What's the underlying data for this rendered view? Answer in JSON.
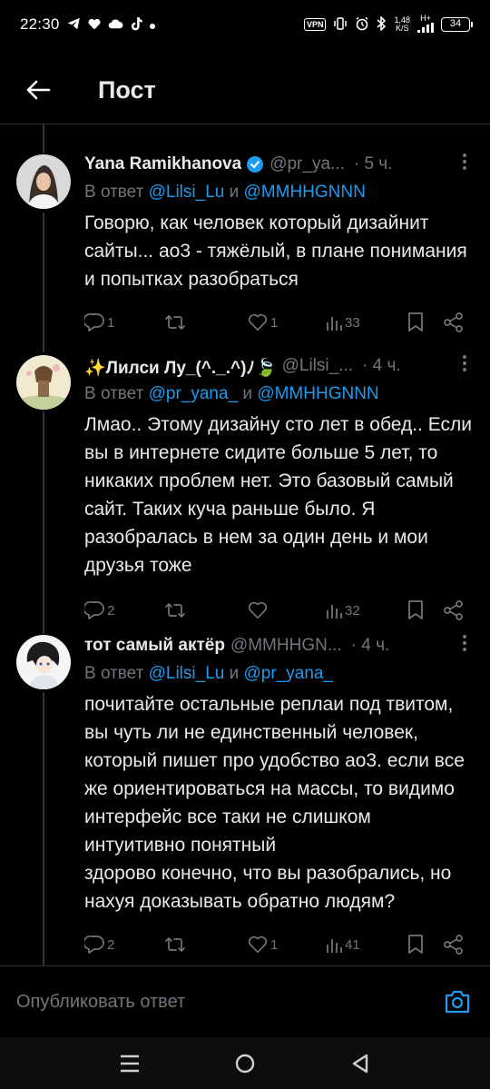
{
  "status_bar": {
    "time": "22:30",
    "vpn": "VPN",
    "speed_value": "1,48",
    "speed_unit": "K/S",
    "network": "H+",
    "battery": "34"
  },
  "header": {
    "title": "Пост"
  },
  "tweets": [
    {
      "name": "Yana Ramikhanova",
      "verified": true,
      "handle": "@pr_ya...",
      "time": "· 5 ч.",
      "reply_prefix": "В ответ ",
      "mention1": "@Lilsi_Lu",
      "conj": " и ",
      "mention2": "@MMHHGNNN",
      "text": "Говорю, как человек который дизайнит сайты... ао3 - тяжёлый, в плане понимания и попытках разобраться",
      "replies": "1",
      "retweets": "",
      "likes": "1",
      "views": "33"
    },
    {
      "name": "✨Лилси Лу_(^._.^)ﾉ🍃",
      "verified": false,
      "handle": "@Lilsi_...",
      "time": "· 4 ч.",
      "reply_prefix": "В ответ ",
      "mention1": "@pr_yana_",
      "conj": " и ",
      "mention2": "@MMHHGNNN",
      "text": "Лмао.. Этому дизайну сто лет в обед.. Если вы в интернете сидите больше 5 лет, то никаких проблем нет. Это базовый самый сайт. Таких куча раньше было. Я разобралась в нем за один день и мои друзья тоже",
      "replies": "2",
      "retweets": "",
      "likes": "",
      "views": "32"
    },
    {
      "name": "тот самый актёр",
      "verified": false,
      "handle": "@MMHHGN...",
      "time": "· 4 ч.",
      "reply_prefix": "В ответ ",
      "mention1": "@Lilsi_Lu",
      "conj": " и ",
      "mention2": "@pr_yana_",
      "text": "почитайте остальные реплаи под твитом, вы чуть ли не единственный человек, который пишет про удобство ао3. если все же ориентироваться на массы, то видимо интерфейс все таки не слишком интуитивно понятный\nздорово конечно, что вы разобрались, но нахуя доказывать обратно людям?",
      "replies": "2",
      "retweets": "",
      "likes": "1",
      "views": "41"
    }
  ],
  "composer": {
    "placeholder": "Опубликовать ответ"
  },
  "colors": {
    "background": "#000000",
    "text": "#e7e9ea",
    "muted": "#71767b",
    "accent": "#1d9bf0",
    "divider": "#2f3336"
  },
  "icons": [
    "back-arrow-icon",
    "verified-badge-icon",
    "more-dots-icon",
    "reply-icon",
    "retweet-icon",
    "like-icon",
    "views-icon",
    "bookmark-icon",
    "share-icon",
    "camera-icon",
    "recents-icon",
    "home-icon",
    "back-triangle-icon"
  ]
}
